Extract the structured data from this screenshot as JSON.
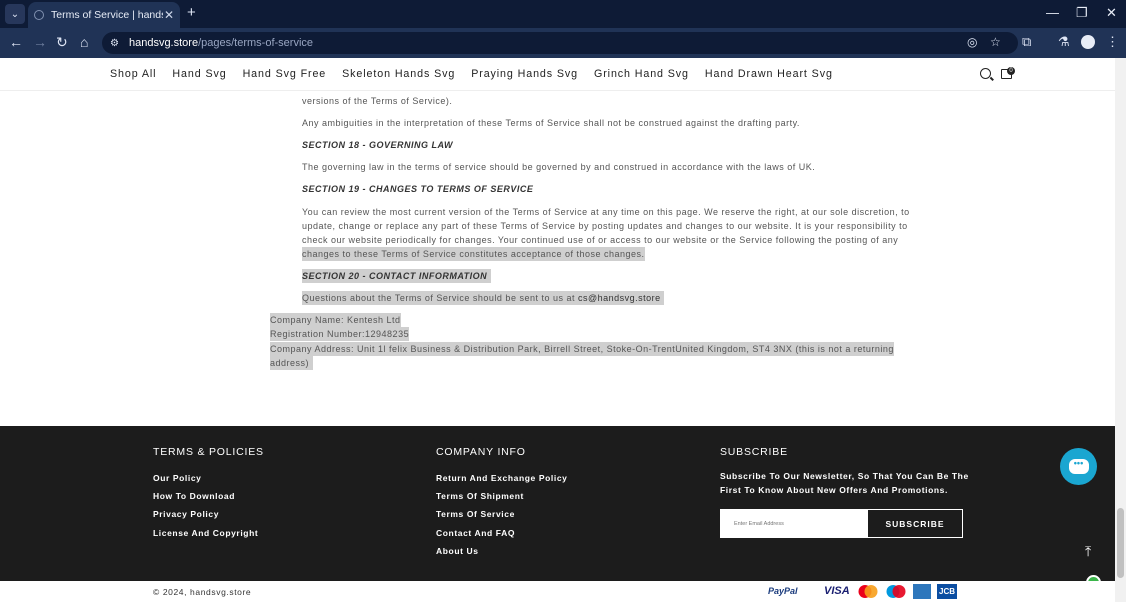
{
  "browser": {
    "tab_title": "Terms of Service | handsvg.store",
    "url_domain": "handsvg.store",
    "url_path": "/pages/terms-of-service"
  },
  "nav": {
    "items": [
      "Shop All",
      "Hand Svg",
      "Hand Svg Free",
      "Skeleton Hands Svg",
      "Praying Hands Svg",
      "Grinch Hand Svg",
      "Hand Drawn Heart Svg"
    ],
    "cart_count": "0"
  },
  "content": {
    "p1": "versions of the Terms of Service).",
    "p2": "Any ambiguities in the interpretation of these Terms of Service shall not be construed against the drafting party.",
    "s18": "SECTION 18 - GOVERNING LAW",
    "p3": "The governing law in the terms of service should be governed by and construed in accordance with the laws of UK.",
    "s19": "SECTION 19 - CHANGES TO TERMS OF SERVICE",
    "p4a": "You can review the most current version of the Terms of Service at any time on this page. We reserve the right, at our sole discretion, to",
    "p4b": "update, change or replace any part of these Terms of Service by posting updates and changes to our website. It is your responsibility to",
    "p4c": "check our website periodically for changes. Your continued use of or access to our website or the Service following the posting of any",
    "p4d": "changes to these Terms of Service constitutes acceptance of those changes.",
    "s20": "SECTION 20 - CONTACT INFORMATION",
    "p5": "Questions about the Terms of Service should be sent to us at ",
    "email": "cs@handsvg.store",
    "company": "Company Name: Kentesh Ltd",
    "reg": "Registration Number:12948235",
    "addr1": "Company Address: Unit 1l felix Business & Distribution Park, Birrell Street, Stoke-On-TrentUnited Kingdom, ST4 3NX (this is not a returning",
    "addr2": "address)"
  },
  "footer": {
    "col1": {
      "title": "TERMS & POLICIES",
      "links": [
        "Our Policy",
        "How To Download",
        "Privacy Policy",
        "License And Copyright"
      ]
    },
    "col2": {
      "title": "COMPANY INFO",
      "links": [
        "Return And Exchange Policy",
        "Terms Of Shipment",
        "Terms Of Service",
        "Contact And FAQ",
        "About Us"
      ]
    },
    "col3": {
      "title": "SUBSCRIBE",
      "text": "Subscribe To Our Newsletter, So That You Can Be The First To Know About New Offers And Promotions.",
      "placeholder": "Enter Email Address",
      "button": "SUBSCRIBE"
    },
    "copyright": "© 2024, handsvg.store",
    "payments": {
      "paypal": "PayPal",
      "visa": "VISA",
      "jcb": "JCB"
    }
  },
  "colors": {
    "footer_bg": "#1c1c1c",
    "chat": "#1aa6d1",
    "highlight": "#cfcfcf"
  }
}
